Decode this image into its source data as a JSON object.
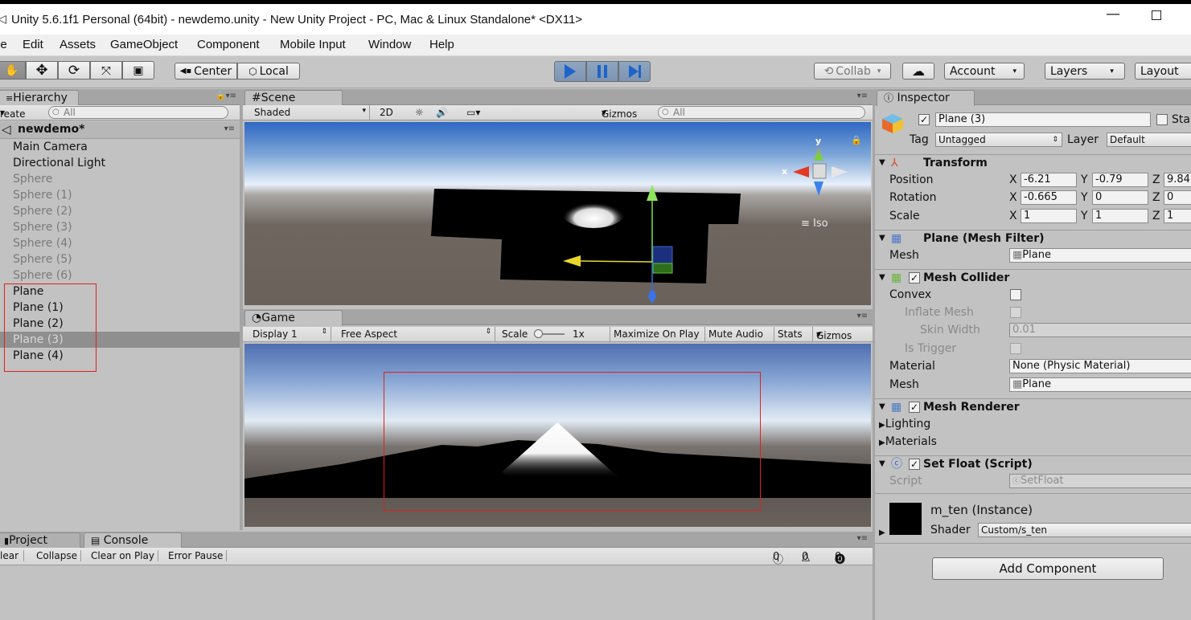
{
  "window": {
    "title": "Unity 5.6.1f1 Personal (64bit) - newdemo.unity - New Unity Project - PC, Mac & Linux Standalone* <DX11>",
    "min_glyph": "—"
  },
  "menu": [
    "le",
    "Edit",
    "Assets",
    "GameObject",
    "Component",
    "Mobile Input",
    "Window",
    "Help"
  ],
  "toolbar": {
    "center": "Center",
    "local": "Local",
    "collab": "Collab",
    "account": "Account",
    "layers": "Layers",
    "layout": "Layout"
  },
  "hierarchy": {
    "tab": "Hierarchy",
    "create": "reate",
    "search": "All",
    "scene": "newdemo*",
    "items": [
      {
        "label": "Main Camera",
        "state": "normal"
      },
      {
        "label": "Directional Light",
        "state": "normal"
      },
      {
        "label": "Sphere",
        "state": "disabled"
      },
      {
        "label": "Sphere (1)",
        "state": "disabled"
      },
      {
        "label": "Sphere (2)",
        "state": "disabled"
      },
      {
        "label": "Sphere (3)",
        "state": "disabled"
      },
      {
        "label": "Sphere (4)",
        "state": "disabled"
      },
      {
        "label": "Sphere (5)",
        "state": "disabled"
      },
      {
        "label": "Sphere (6)",
        "state": "disabled"
      },
      {
        "label": "Plane",
        "state": "normal"
      },
      {
        "label": "Plane (1)",
        "state": "normal"
      },
      {
        "label": "Plane (2)",
        "state": "normal"
      },
      {
        "label": "Plane (3)",
        "state": "selected"
      },
      {
        "label": "Plane (4)",
        "state": "normal"
      }
    ]
  },
  "scene": {
    "tab": "Scene",
    "shading": "Shaded",
    "mode2d": "2D",
    "gizmos": "Gizmos",
    "search": "All",
    "iso": "Iso",
    "axis_x": "x",
    "axis_y": "y"
  },
  "game": {
    "tab": "Game",
    "display": "Display 1",
    "aspect": "Free Aspect",
    "scale_label": "Scale",
    "scale_value": "1x",
    "maximize": "Maximize On Play",
    "mute": "Mute Audio",
    "stats": "Stats",
    "gizmos": "Gizmos"
  },
  "console": {
    "project_tab": "Project",
    "console_tab": "Console",
    "clear": "lear",
    "collapse": "Collapse",
    "clear_on_play": "Clear on Play",
    "error_pause": "Error Pause",
    "info_count": "0",
    "warn_count": "0",
    "error_count": "0"
  },
  "inspector": {
    "tab": "Inspector",
    "name": "Plane (3)",
    "static": "Sta",
    "tag_label": "Tag",
    "tag": "Untagged",
    "layer_label": "Layer",
    "layer": "Default",
    "transform": {
      "title": "Transform",
      "position_label": "Position",
      "rotation_label": "Rotation",
      "scale_label": "Scale",
      "position": {
        "x": "-6.21",
        "y": "-0.79",
        "z": "9.84"
      },
      "rotation": {
        "x": "-0.665",
        "y": "0",
        "z": "0"
      },
      "scale": {
        "x": "1",
        "y": "1",
        "z": "1"
      }
    },
    "mesh_filter": {
      "title": "Plane (Mesh Filter)",
      "mesh_label": "Mesh",
      "mesh": "Plane"
    },
    "mesh_collider": {
      "title": "Mesh Collider",
      "convex": "Convex",
      "inflate": "Inflate Mesh",
      "skin_width_label": "Skin Width",
      "skin_width": "0.01",
      "is_trigger": "Is Trigger",
      "material_label": "Material",
      "material": "None (Physic Material)",
      "mesh_label": "Mesh",
      "mesh": "Plane"
    },
    "mesh_renderer": {
      "title": "Mesh Renderer",
      "lighting": "Lighting",
      "materials": "Materials"
    },
    "set_float": {
      "title": "Set Float (Script)",
      "script_label": "Script",
      "script": "SetFloat"
    },
    "material": {
      "name": "m_ten (Instance)",
      "shader_label": "Shader",
      "shader": "Custom/s_ten"
    },
    "add_component": "Add Component"
  }
}
